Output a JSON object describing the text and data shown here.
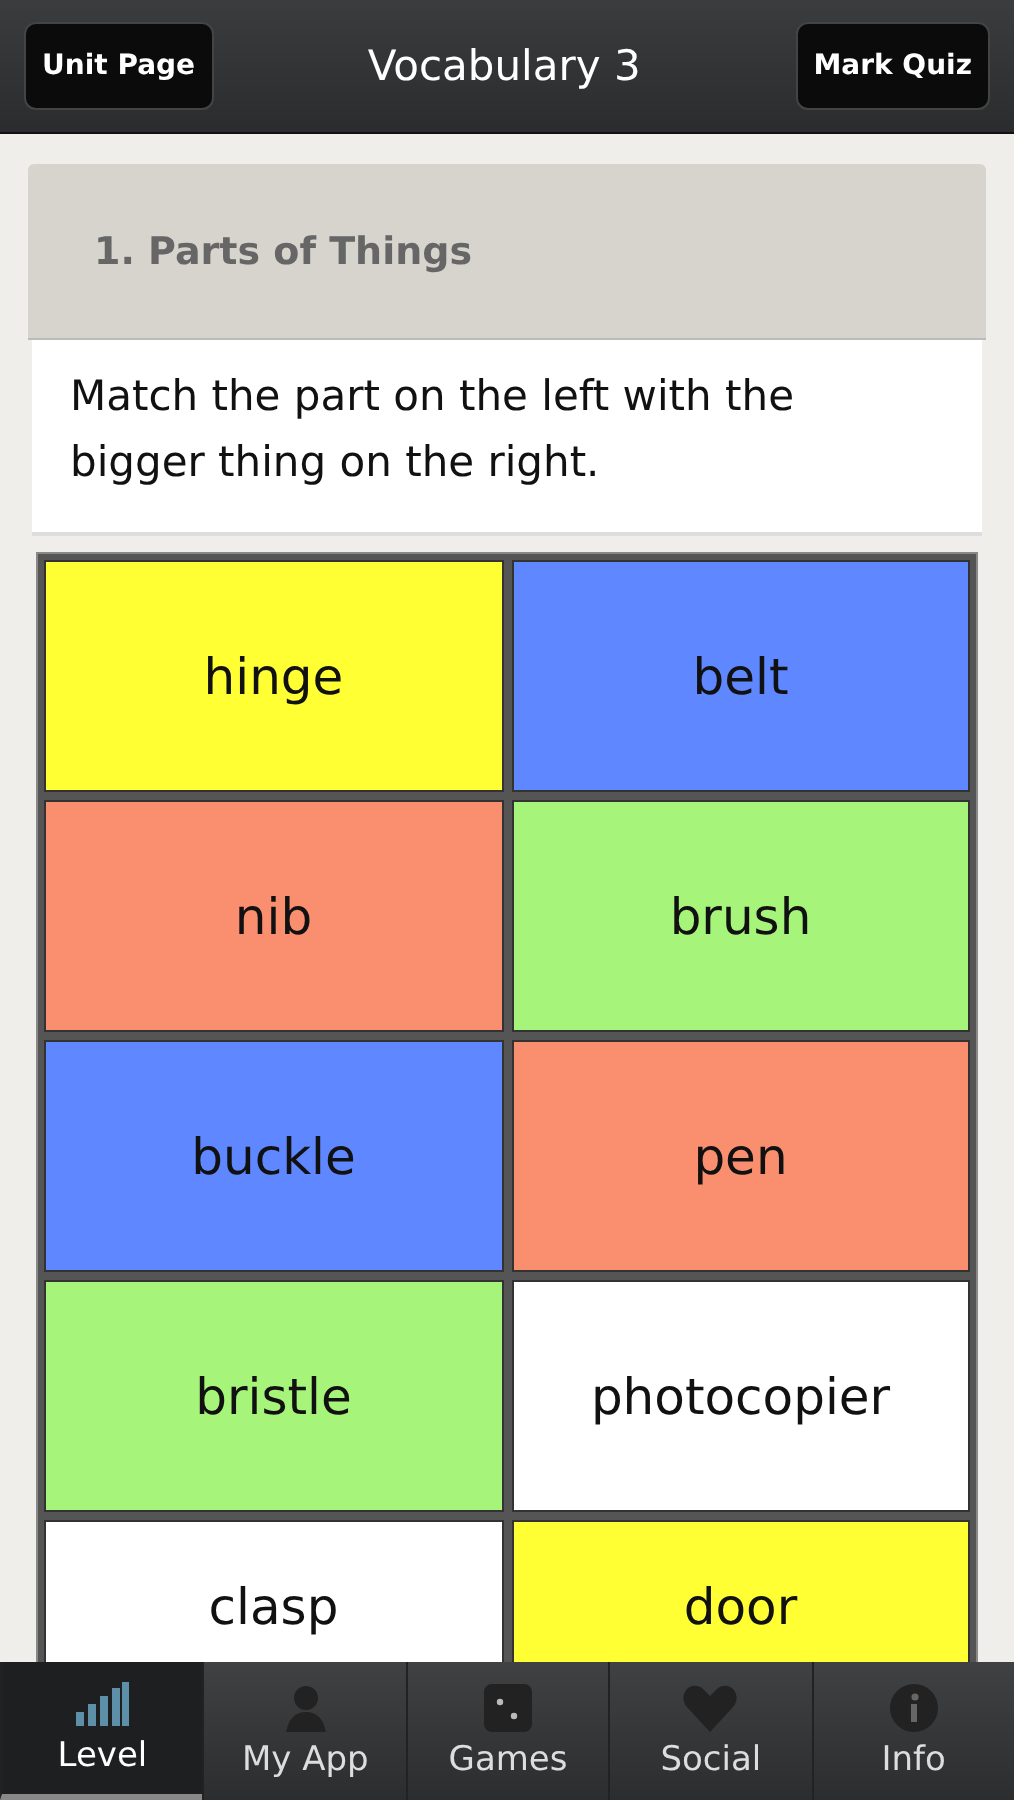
{
  "header": {
    "left_button": "Unit Page",
    "title": "Vocabulary 3",
    "right_button": "Mark Quiz"
  },
  "section": {
    "heading": "1. Parts of Things",
    "instruction": "Match the part on the left with the bigger thing on the right."
  },
  "cards": [
    {
      "text": "hinge",
      "color": "#ffff33"
    },
    {
      "text": "belt",
      "color": "#5f87ff"
    },
    {
      "text": "nib",
      "color": "#f98f6f"
    },
    {
      "text": "brush",
      "color": "#a6f57a"
    },
    {
      "text": "buckle",
      "color": "#5f87ff"
    },
    {
      "text": "pen",
      "color": "#f98f6f"
    },
    {
      "text": "bristle",
      "color": "#a6f57a"
    },
    {
      "text": "photocopier",
      "color": "#ffffff"
    },
    {
      "text": "clasp",
      "color": "#ffffff"
    },
    {
      "text": "door",
      "color": "#ffff33"
    }
  ],
  "tabs": [
    {
      "label": "Level",
      "selected": true
    },
    {
      "label": "My App",
      "selected": false
    },
    {
      "label": "Games",
      "selected": false
    },
    {
      "label": "Social",
      "selected": false
    },
    {
      "label": "Info",
      "selected": false
    }
  ]
}
